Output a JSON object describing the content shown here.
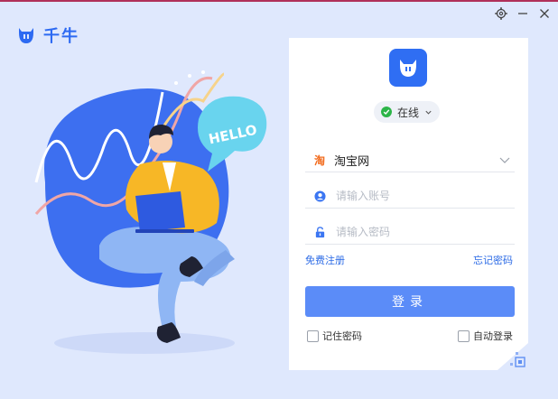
{
  "app": {
    "name": "千牛",
    "brand_color": "#2d6af2"
  },
  "illustration": {
    "bubble_text": "HELLO"
  },
  "status": {
    "label": "在线",
    "color": "#2cb548"
  },
  "platform": {
    "selected": "淘宝网",
    "icon_text": "淘"
  },
  "account": {
    "placeholder": "请输入账号",
    "value": ""
  },
  "password": {
    "placeholder": "请输入密码",
    "value": ""
  },
  "links": {
    "register": "免费注册",
    "forgot": "忘记密码"
  },
  "login": {
    "label": "登录",
    "color": "#5b8cf8"
  },
  "options": {
    "remember": "记住密码",
    "auto_login": "自动登录"
  },
  "icons": {
    "settings": "gear-icon",
    "minimize": "minimize-icon",
    "close": "close-icon",
    "qr": "qr-code-icon"
  }
}
